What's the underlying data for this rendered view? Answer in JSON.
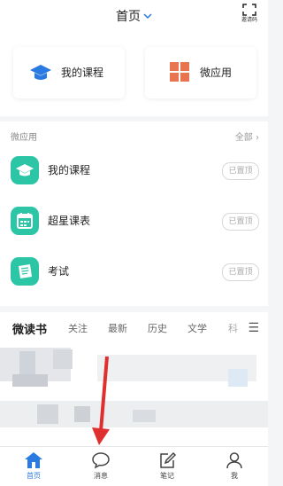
{
  "header": {
    "title": "首页",
    "invite_label": "邀请码"
  },
  "quick_cards": [
    {
      "label": "我的课程",
      "icon": "graduation-cap-icon"
    },
    {
      "label": "微应用",
      "icon": "grid-icon"
    }
  ],
  "apps_section": {
    "title": "微应用",
    "all_label": "全部 ›",
    "items": [
      {
        "name": "我的课程",
        "icon": "graduation-cap-icon",
        "status": "已置顶"
      },
      {
        "name": "超星课表",
        "icon": "calendar-icon",
        "status": "已置顶"
      },
      {
        "name": "考试",
        "icon": "exam-icon",
        "status": "已置顶"
      }
    ]
  },
  "tabs": {
    "items": [
      "微读书",
      "关注",
      "最新",
      "历史",
      "文学",
      "科"
    ],
    "active": "微读书",
    "menu_icon": "☰"
  },
  "bottom_nav": {
    "items": [
      {
        "label": "首页",
        "icon": "home-icon",
        "active": true
      },
      {
        "label": "消息",
        "icon": "chat-bubble-icon",
        "active": false
      },
      {
        "label": "笔记",
        "icon": "note-edit-icon",
        "active": false
      },
      {
        "label": "我",
        "icon": "user-icon",
        "active": false
      }
    ]
  },
  "colors": {
    "accent": "#2a7ae2",
    "app_green": "#2cc6a6",
    "orange": "#e8754f",
    "annotation_red": "#e02f2f"
  }
}
